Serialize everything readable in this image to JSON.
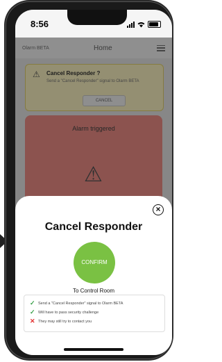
{
  "status": {
    "time": "8:56"
  },
  "appbar": {
    "logo": "Olarm BETA",
    "title": "Home"
  },
  "warning_card": {
    "title": "Cancel Responder ?",
    "text": "Send a \"Cancel Responder\" signal to Olarm BETA",
    "button": "CANCEL"
  },
  "red_card": {
    "title": "Alarm triggered"
  },
  "sheet": {
    "title": "Cancel Responder",
    "confirm": "CONFIRM",
    "control_room": "To Control Room",
    "items": [
      {
        "mark": "✓",
        "status": "ok",
        "text": "Send a \"Cancel Responder\" signal to Olarm BETA"
      },
      {
        "mark": "✓",
        "status": "ok",
        "text": "Will have to pass security challenge"
      },
      {
        "mark": "✕",
        "status": "no",
        "text": "They may still try to contact you"
      }
    ]
  },
  "colors": {
    "confirm": "#7ac143",
    "ok": "#3aa14a",
    "no": "#e33030"
  }
}
